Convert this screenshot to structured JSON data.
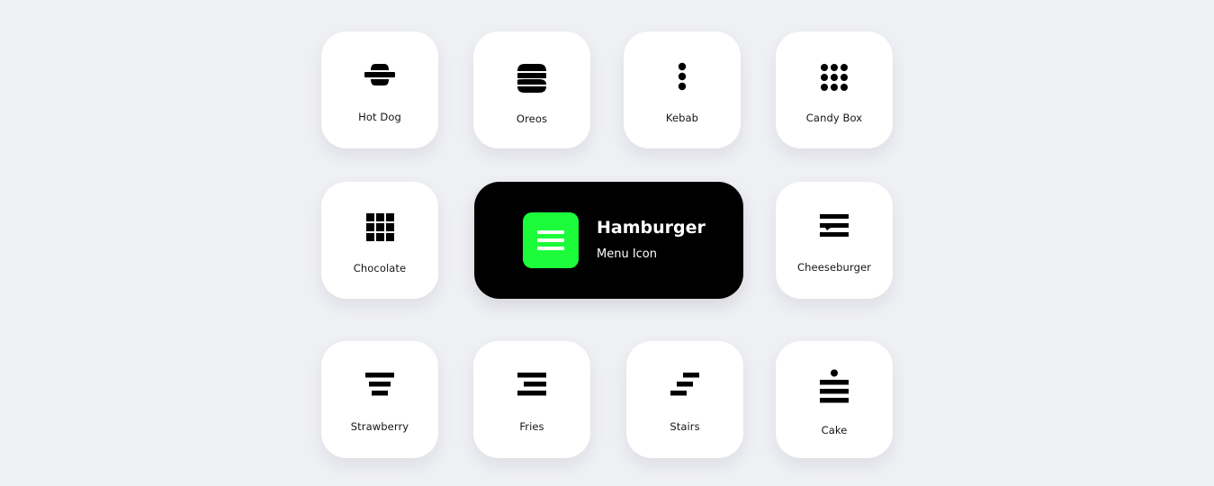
{
  "background_color": "#eff0f4",
  "accent_color": "#1dfc3a",
  "featured": {
    "title": "Hamburger",
    "subtitle": "Menu Icon",
    "icon": "hamburger-menu-icon"
  },
  "cards": [
    {
      "label": "Hot Dog",
      "icon": "hot-dog-menu-icon"
    },
    {
      "label": "Oreos",
      "icon": "oreos-menu-icon"
    },
    {
      "label": "Kebab",
      "icon": "kebab-menu-icon"
    },
    {
      "label": "Candy Box",
      "icon": "candy-box-menu-icon"
    },
    {
      "label": "Chocolate",
      "icon": "chocolate-menu-icon"
    },
    {
      "label": "Cheeseburger",
      "icon": "cheeseburger-menu-icon"
    },
    {
      "label": "Strawberry",
      "icon": "strawberry-menu-icon"
    },
    {
      "label": "Fries",
      "icon": "fries-menu-icon"
    },
    {
      "label": "Stairs",
      "icon": "stairs-menu-icon"
    },
    {
      "label": "Cake",
      "icon": "cake-menu-icon"
    }
  ]
}
